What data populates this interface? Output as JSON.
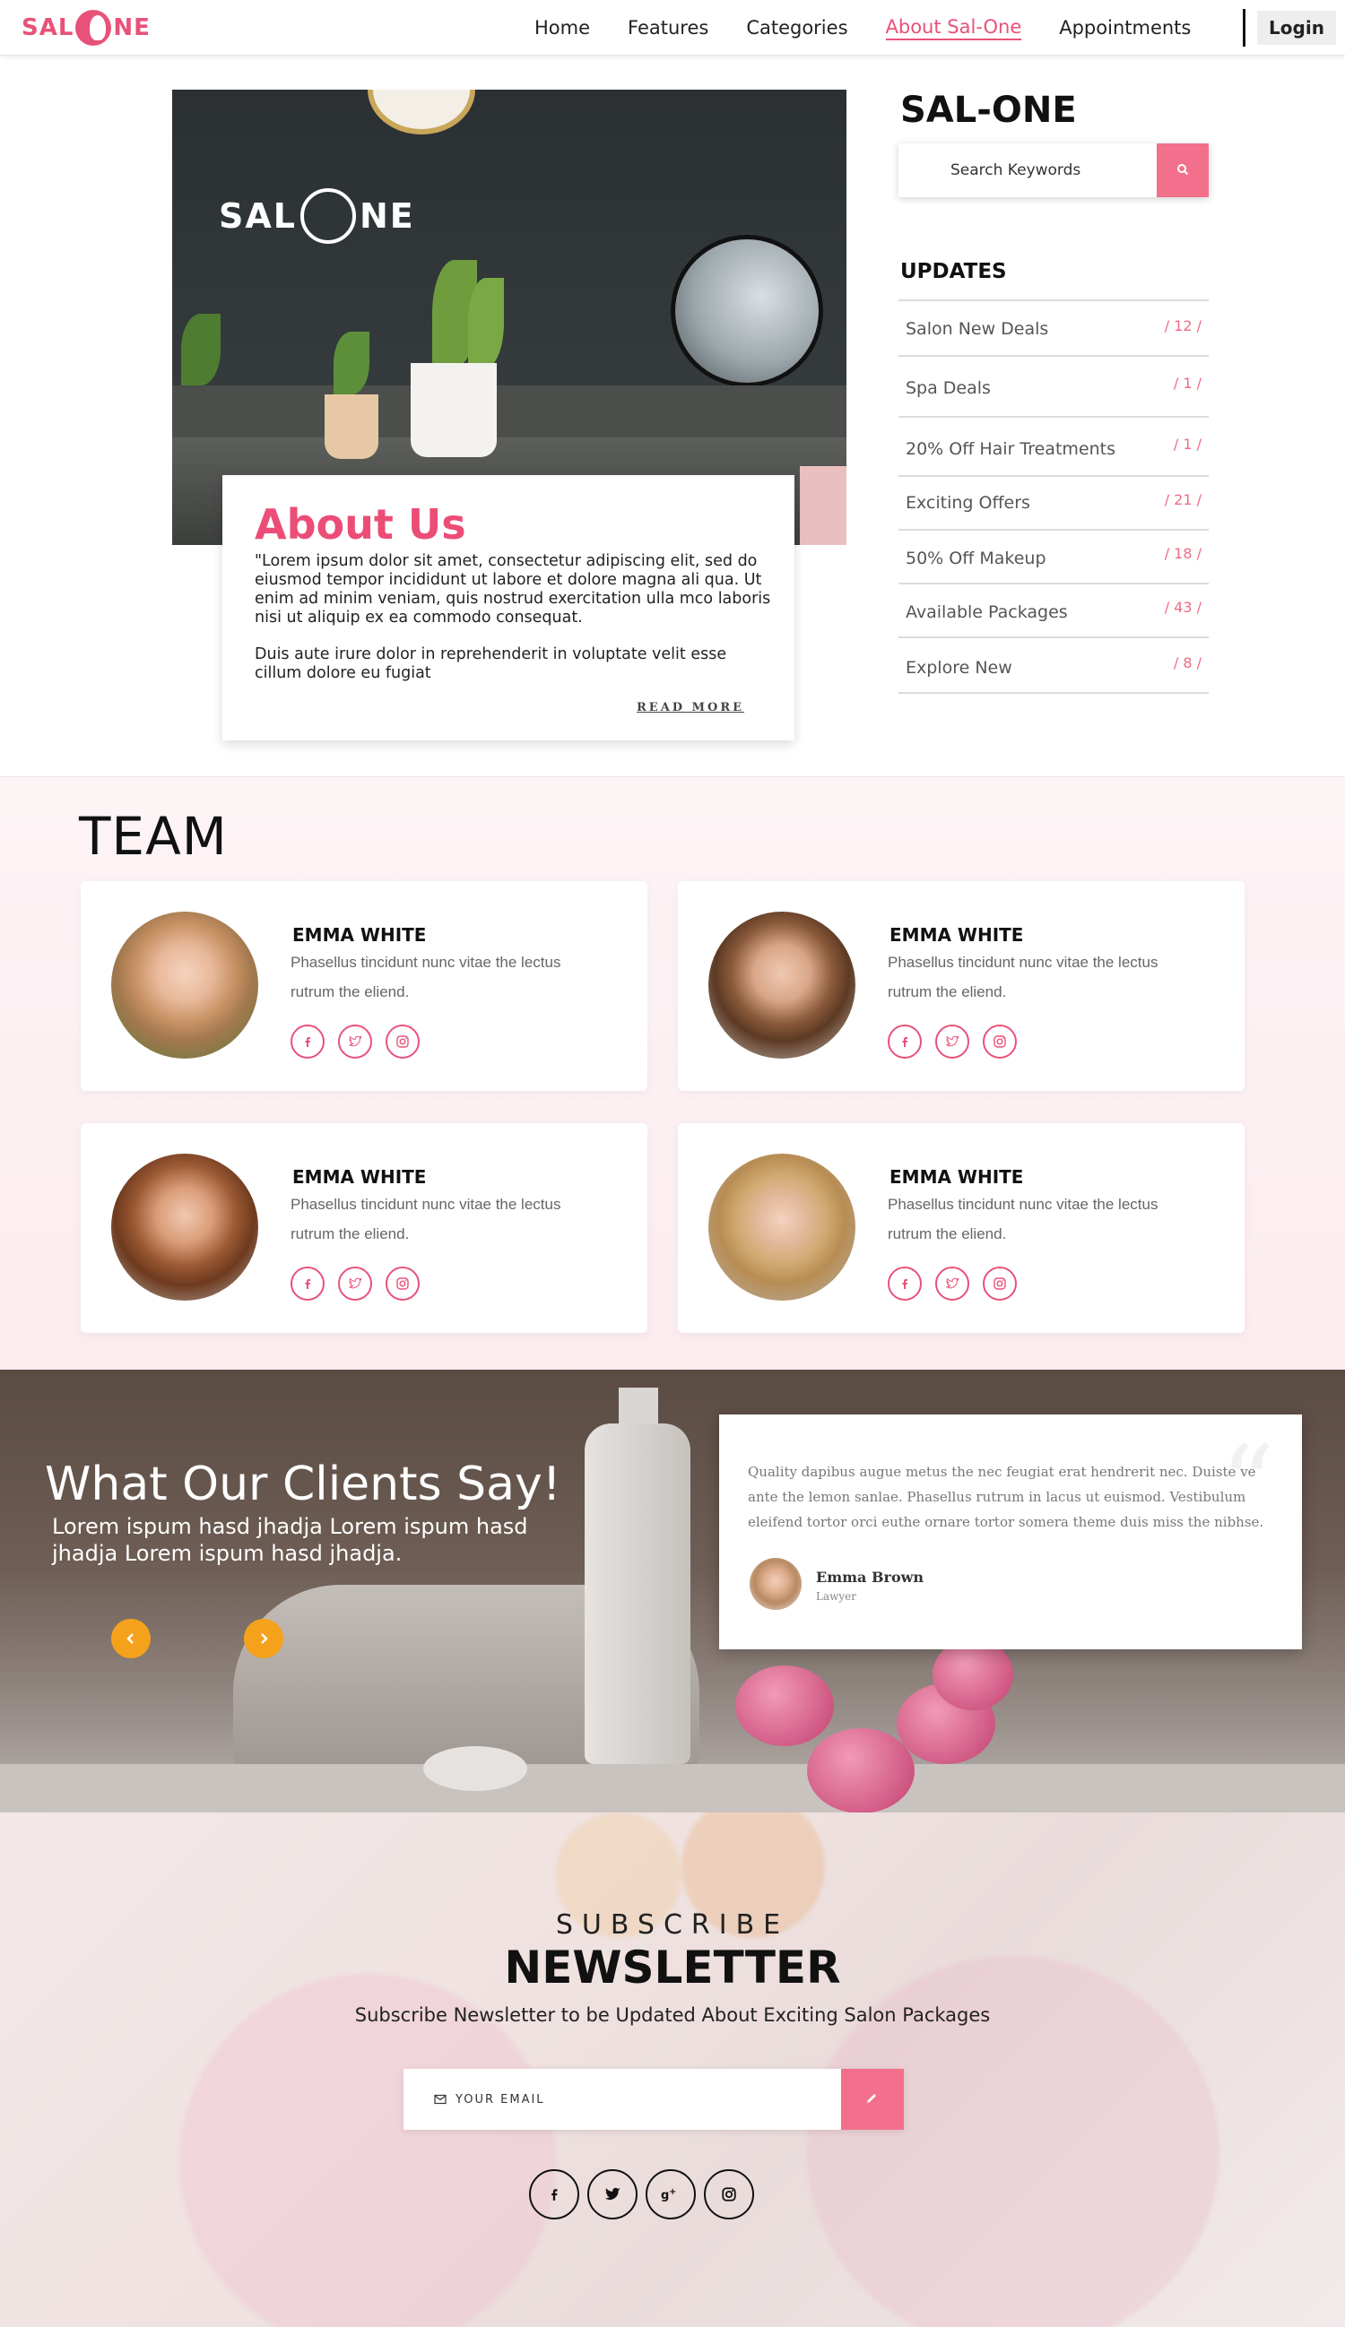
{
  "brand": {
    "name": "SAL-ONE",
    "logo_left": "SAL",
    "logo_right": "NE",
    "accent": "#e8527a",
    "button_pink": "#f2708b",
    "arrow_orange": "#f4a21c"
  },
  "nav": {
    "items": [
      {
        "label": "Home"
      },
      {
        "label": "Features"
      },
      {
        "label": "Categories"
      },
      {
        "label": "About Sal-One",
        "active": true
      },
      {
        "label": "Appointments"
      }
    ],
    "login_label": "Login"
  },
  "about": {
    "title": "About Us",
    "p1": "\"Lorem ipsum dolor sit amet, consectetur adipiscing elit, sed do eiusmod tempor incididunt ut labore et dolore magna ali qua. Ut enim ad minim veniam, quis nostrud exercitation ulla mco laboris nisi ut aliquip ex ea commodo consequat.",
    "p2": "Duis aute irure dolor in reprehenderit in voluptate velit esse cillum dolore eu fugiat",
    "read_more": "READ MORE"
  },
  "sidebar": {
    "title": "SAL-ONE",
    "search_placeholder": "Search Keywords",
    "updates_title": "UPDATES",
    "updates": [
      {
        "label": "Salon New Deals",
        "count": "/ 12 /"
      },
      {
        "label": "Spa Deals",
        "count": "/ 1 /"
      },
      {
        "label": "20% Off Hair Treatments",
        "count": "/ 1 /"
      },
      {
        "label": "Exciting Offers",
        "count": "/ 21 /"
      },
      {
        "label": "50% Off Makeup",
        "count": "/ 18 /"
      },
      {
        "label": "Available Packages",
        "count": "/ 43 /"
      },
      {
        "label": "Explore New",
        "count": "/ 8 /"
      }
    ]
  },
  "team": {
    "title": "TEAM",
    "members": [
      {
        "name": "EMMA WHITE",
        "desc": "Phasellus tincidunt nunc vitae the lectus rutrum the eliend."
      },
      {
        "name": "EMMA WHITE",
        "desc": "Phasellus tincidunt nunc vitae the lectus rutrum the eliend."
      },
      {
        "name": "EMMA WHITE",
        "desc": "Phasellus tincidunt nunc vitae the lectus rutrum the eliend."
      },
      {
        "name": "EMMA WHITE",
        "desc": "Phasellus tincidunt nunc vitae the lectus rutrum the eliend."
      }
    ],
    "social_icons": [
      "facebook-icon",
      "twitter-icon",
      "instagram-icon"
    ]
  },
  "testimonials": {
    "title": "What Our Clients Say!",
    "subtitle": "Lorem ispum hasd jhadja Lorem ispum hasd jhadja Lorem ispum hasd jhadja.",
    "quote": "Quality dapibus augue metus the nec feugiat erat hendrerit nec. Duiste ve ante the lemon sanlae. Phasellus rutrum in lacus ut euismod. Vestibulum eleifend tortor orci euthe ornare tortor somera theme duis miss the nibhse.",
    "author_name": "Emma Brown",
    "author_role": "Lawyer"
  },
  "newsletter": {
    "kicker": "SUBSCRIBE",
    "title": "NEWSLETTER",
    "subtitle": "Subscribe Newsletter to be Updated About Exciting Salon Packages",
    "email_placeholder": "YOUR EMAIL",
    "social_icons": [
      "facebook-icon",
      "twitter-icon",
      "google-plus-icon",
      "instagram-icon"
    ]
  }
}
